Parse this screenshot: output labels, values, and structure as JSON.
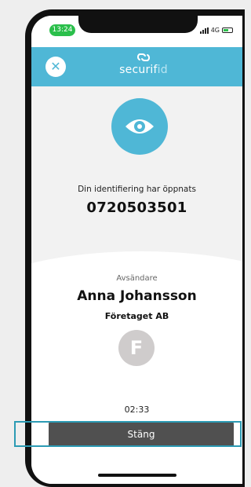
{
  "status_bar": {
    "time": "13:24",
    "network": "4G"
  },
  "header": {
    "close_icon": "close-icon",
    "logo_text_dark": "securif",
    "logo_text_light": "id"
  },
  "identification": {
    "opened_label": "Din identifiering har öppnats",
    "phone_number": "0720503501"
  },
  "sender": {
    "label": "Avsändare",
    "name": "Anna Johansson",
    "company": "Företaget AB",
    "avatar_initial": "F"
  },
  "timer": "02:33",
  "actions": {
    "close_button_label": "Stäng"
  },
  "colors": {
    "accent": "#4fb7d6",
    "button": "#505050",
    "highlight": "#2c9bb4",
    "time_pill": "#2bbf4b"
  }
}
